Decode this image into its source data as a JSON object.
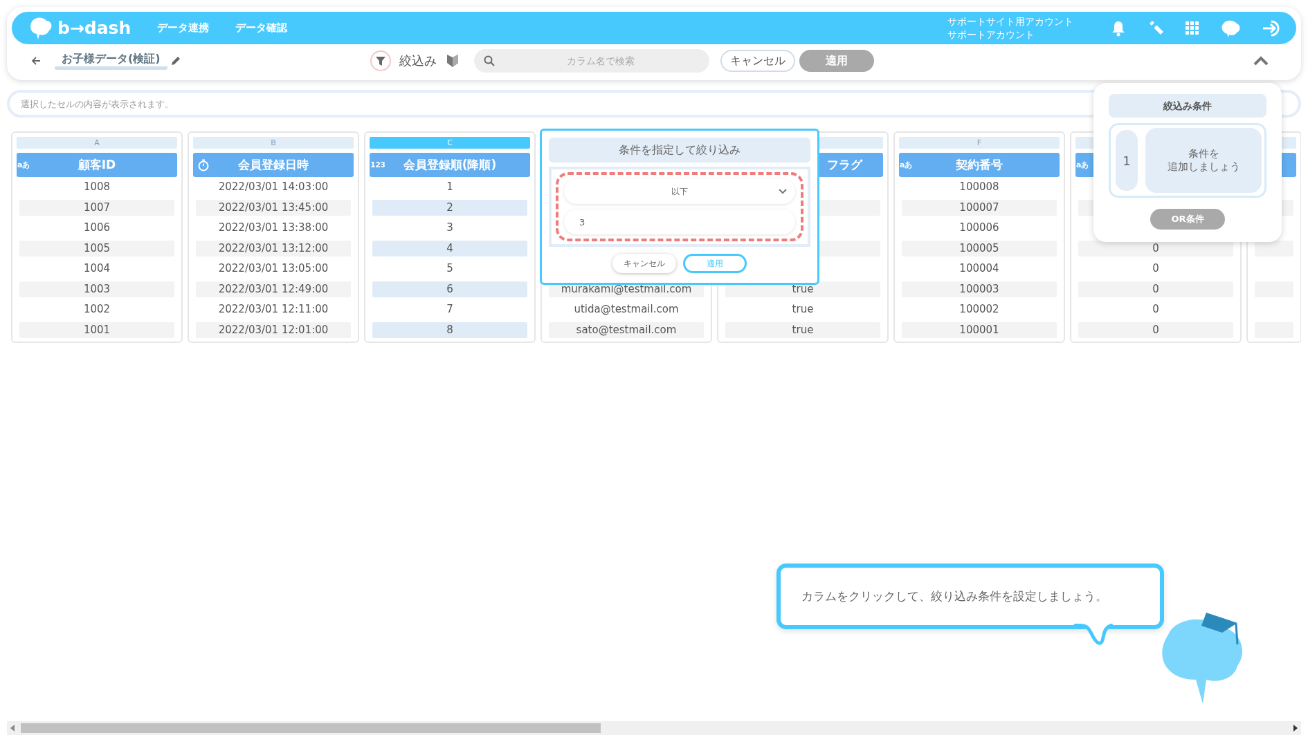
{
  "header": {
    "logo": "b→dash",
    "nav": [
      {
        "label": "データ連携"
      },
      {
        "label": "データ確認"
      }
    ],
    "account": {
      "site": "サポートサイト用アカウント",
      "name": "サポートアカウント"
    }
  },
  "toolbar": {
    "dataset_title": "お子様データ(検証)",
    "filter_label": "絞込み",
    "search": {
      "placeholder": "カラム名で検索"
    },
    "cancel": {
      "label": "キャンセル",
      "disabled": false
    },
    "apply": {
      "label": "適用",
      "disabled": true
    }
  },
  "cell_viewer": {
    "placeholder": "選択したセルの内容が表示されます。"
  },
  "columns": [
    {
      "letter": "A",
      "kind": "label",
      "type_label": "aあ",
      "title": "顧客ID",
      "selected": false,
      "cells": [
        "1008",
        "1007",
        "1006",
        "1005",
        "1004",
        "1003",
        "1002",
        "1001"
      ]
    },
    {
      "letter": "B",
      "kind": "stopwatch",
      "title": "会員登録日時",
      "selected": false,
      "cells": [
        "2022/03/01 14:03:00",
        "2022/03/01 13:45:00",
        "2022/03/01 13:38:00",
        "2022/03/01 13:12:00",
        "2022/03/01 13:05:00",
        "2022/03/01 12:49:00",
        "2022/03/01 12:11:00",
        "2022/03/01 12:01:00"
      ]
    },
    {
      "letter": "C",
      "kind": "label",
      "type_label": "123",
      "title": "会員登録順(降順)",
      "selected": true,
      "cells": [
        "1",
        "2",
        "3",
        "4",
        "5",
        "6",
        "7",
        "8"
      ]
    },
    {
      "kind": "hidden",
      "cells": [
        null,
        null,
        null,
        null,
        null,
        "murakami@testmail.com",
        "utida@testmail.com",
        "sato@testmail.com"
      ]
    },
    {
      "kind": "covered",
      "title": "フラグ",
      "cells": [
        null,
        null,
        null,
        null,
        null,
        "true",
        "true",
        "true"
      ]
    },
    {
      "letter": "F",
      "kind": "label",
      "type_label": "aあ",
      "title": "契約番号",
      "selected": false,
      "cells": [
        "100008",
        "100007",
        "100006",
        "100005",
        "100004",
        "100003",
        "100002",
        "100001"
      ]
    },
    {
      "kind": "label",
      "type_label": "aあ",
      "cells": [
        null,
        null,
        null,
        "0",
        "0",
        "0",
        "0",
        "0"
      ]
    },
    {
      "kind": "covered",
      "cells": [
        null,
        null,
        null,
        null,
        null,
        null,
        null,
        null
      ]
    }
  ],
  "condition_popup": {
    "title": "条件を指定して絞り込み",
    "operator": "以下",
    "value": "3",
    "cancel": "キャンセル",
    "apply": "適用"
  },
  "filter_panel": {
    "title": "絞込み条件",
    "group_number": "1",
    "hint_lines": [
      "条件を",
      "追加しましょう"
    ],
    "or_button": {
      "label": "OR条件",
      "disabled": true
    }
  },
  "guide": {
    "message": "カラムをクリックして、絞り込み条件を設定しましょう。"
  }
}
